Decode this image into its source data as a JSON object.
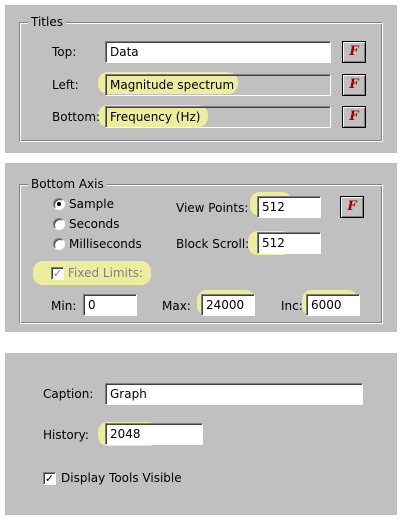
{
  "titles": {
    "legend": "Titles",
    "top": {
      "label": "Top:",
      "value": "Data"
    },
    "left": {
      "label": "Left:",
      "value": "Magnitude spectrum"
    },
    "bottom": {
      "label": "Bottom:",
      "value": "Frequency (Hz)"
    },
    "font_button": "F"
  },
  "bottom_axis": {
    "legend": "Bottom Axis",
    "units": {
      "options": [
        "Sample",
        "Seconds",
        "Milliseconds"
      ],
      "selected": "Sample"
    },
    "view_points": {
      "label": "View Points:",
      "value": "512"
    },
    "block_scroll": {
      "label": "Block Scroll:",
      "value": "512"
    },
    "font_button": "F",
    "fixed_limits": {
      "label": "Fixed Limits:",
      "checked": true
    },
    "min": {
      "label": "Min:",
      "value": "0"
    },
    "max": {
      "label": "Max:",
      "value": "24000"
    },
    "inc": {
      "label": "Inc:",
      "value": "6000"
    }
  },
  "general": {
    "caption": {
      "label": "Caption:",
      "value": "Graph"
    },
    "history": {
      "label": "History:",
      "value": "2048"
    },
    "display_tools": {
      "label": "Display Tools Visible",
      "checked": true
    }
  },
  "colors": {
    "panel": "#c0c0c0",
    "highlight": "#f4f49a",
    "font_button_glyph": "#a00000"
  }
}
